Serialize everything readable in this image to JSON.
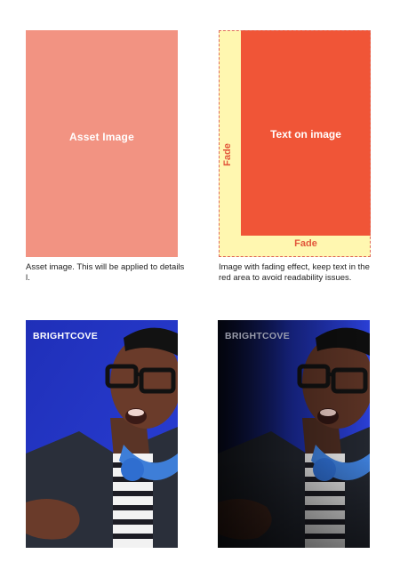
{
  "top_left": {
    "label": "Asset Image",
    "caption": "Asset image. This will be applied to details l.",
    "color": "#f29382"
  },
  "top_right": {
    "main_label": "Text on image",
    "fade_left_label": "Fade",
    "fade_bottom_label": "Fade",
    "caption": "Image with fading effect, keep text in the red area to avoid readability issues.",
    "red_color": "#f05537",
    "fade_color": "#fff7b0"
  },
  "photos": {
    "brand_left": "BRIGHTCOVE",
    "brand_right": "BRIGHTCOVE"
  }
}
